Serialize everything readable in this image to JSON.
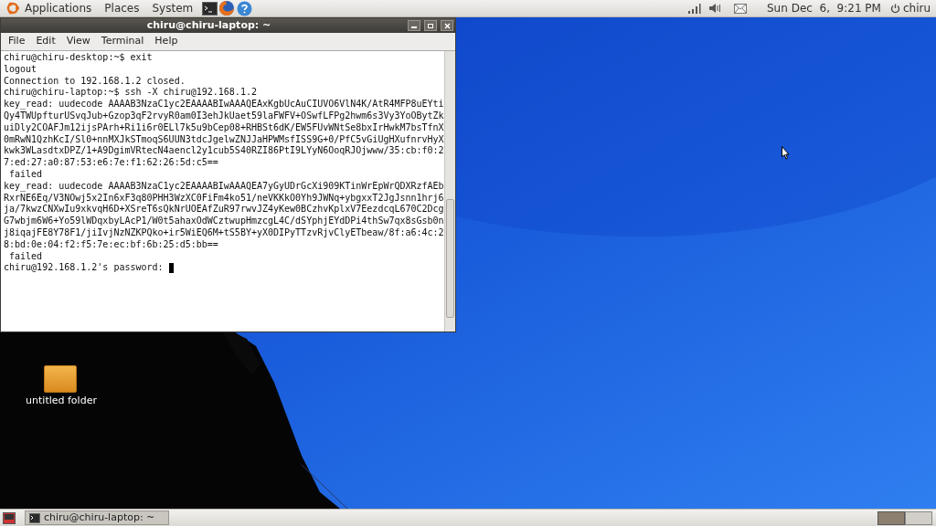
{
  "top_panel": {
    "menus": [
      "Applications",
      "Places",
      "System"
    ],
    "clock": "Sun Dec  6,  9:21 PM",
    "user": "chiru"
  },
  "terminal": {
    "title": "chiru@chiru-laptop: ~",
    "menu": [
      "File",
      "Edit",
      "View",
      "Terminal",
      "Help"
    ],
    "cursor": true,
    "lines": [
      "chiru@chiru-desktop:~$ exit",
      "logout",
      "Connection to 192.168.1.2 closed.",
      "chiru@chiru-laptop:~$ ssh -X chiru@192.168.1.2",
      "key_read: uudecode AAAAB3NzaC1yc2EAAAABIwAAAQEAxKgbUcAuCIUVO6VlN4K/AtR4MFP8uEYti",
      "Qy4TWUpfturUSvqJub+Gzop3qF2rvyR0am0I3ehJkUaet59laFWFV+OSwfLFPg2hwm6s3Vy3YoOBytZk",
      "uiDly2COAFJm12ijsPArh+Ri1i6r0ELl7k5u9bCep08+RHBSt6dK/EW5FUvWNtSe8bxIrHwkM7bsTfnX",
      "0mRwN1QzhKcI/Sl0+nnMXJkSTmoqS6UUN3tdcJgelwZNJJaHPWMsfISS9G+0/PfC5vGiUgHXufnrvHyX",
      "kwk3WLasdtxDPZ/1+A9DgimVRtecN4aencl2y1cub5S40RZI86PtI9LYyN6OoqRJOjwww/35:cb:f0:2",
      "7:ed:27:a0:87:53:e6:7e:f1:62:26:5d:c5==",
      " failed",
      "key_read: uudecode AAAAB3NzaC1yc2EAAAABIwAAAQEA7yGyUDrGcXi909KTinWrEpWrQDXRzfAEb",
      "RxrNE6Eq/V3NOwj5x2In6xF3q80PHH3WzXC0FiFm4ko51/neVKKkO0Yh9JWNq+ybgxxT2JgJsnn1hrj6",
      "ja/7kwzCNXwIu9xkvqH6D+XSreT6sQkNrUOEAfZuR97rwvJZ4yKew0BCzhvKplxV7EezdcqL670C2Dcg",
      "G7wbjm6W6+Yo59lWDqxbyLAcP1/W0t5ahaxOdWCztwupHmzcgL4C/dSYphjEYdDPi4thSw7qx8sGsb0n",
      "j8iqajFE8Y78F1/jiIvjNzNZKPQko+ir5WiEQ6M+tS5BY+yX0DIPyTTzvRjvClyETbeaw/8f:a6:4c:2",
      "8:bd:0e:04:f2:f5:7e:ec:bf:6b:25:d5:bb==",
      " failed",
      "chiru@192.168.1.2's password: "
    ]
  },
  "desktop_icons": [
    {
      "label": "untitled folder"
    }
  ],
  "taskbar": {
    "items": [
      {
        "label": "chiru@chiru-laptop: ~",
        "selected": true
      }
    ],
    "workspaces": [
      {
        "selected": true
      },
      {
        "selected": false
      }
    ]
  }
}
